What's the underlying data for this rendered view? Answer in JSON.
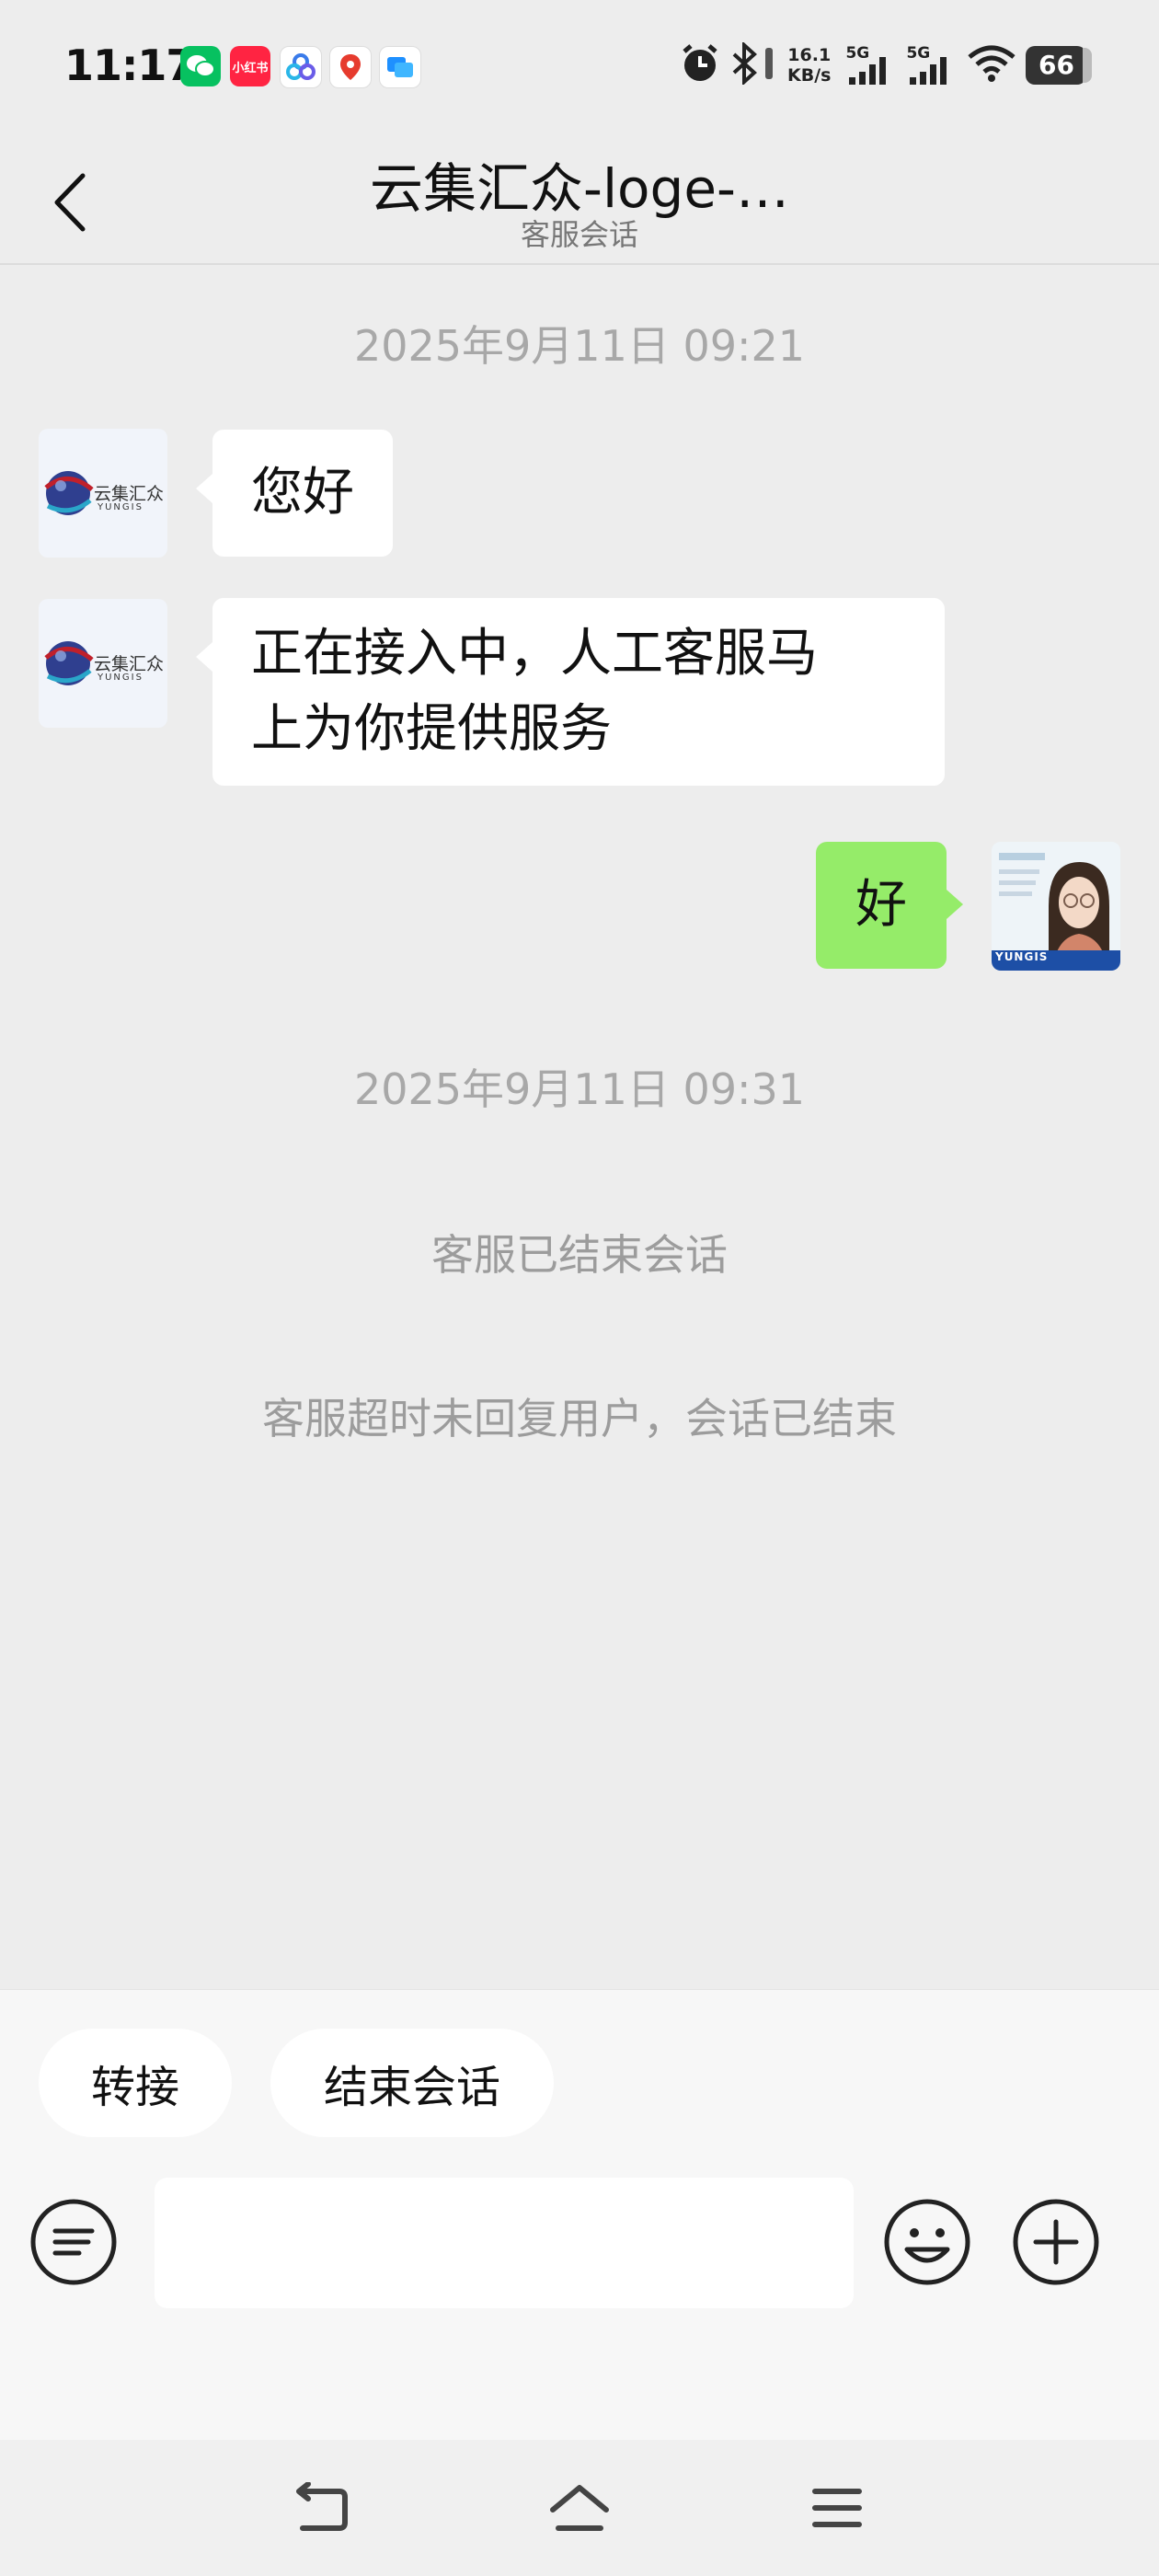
{
  "status_bar": {
    "time": "11:17",
    "notif_icons": [
      "wechat-icon",
      "xiaohongshu-icon",
      "cloud-app-icon",
      "map-pin-icon",
      "message-app-icon"
    ],
    "xiaohongshu_label": "小红书",
    "net_speed_value": "16.1",
    "net_speed_unit": "KB/s",
    "sim1_label": "5G",
    "sim2_label": "5G",
    "battery": "66"
  },
  "header": {
    "title": "云集汇众-loge-…",
    "subtitle": "客服会话"
  },
  "chat": {
    "bot_logo_text": "云集汇众",
    "bot_logo_sub": "YUNGIS",
    "timestamp_1": "2025年9月11日 09:21",
    "msg_1": "您好",
    "msg_2_line1": "正在接入中，人工客服马",
    "msg_2_line2": "上为你提供服务",
    "msg_3": "好",
    "user_card_brand": "YUNGIS",
    "timestamp_2": "2025年9月11日 09:31",
    "system_1": "客服已结束会话",
    "system_2": "客服超时未回复用户，会话已结束"
  },
  "actions": {
    "transfer_label": "转接",
    "end_session_label": "结束会话"
  },
  "input": {
    "value": "",
    "placeholder": ""
  },
  "colors": {
    "background": "#ededed",
    "bubble_self": "#95ec69",
    "bubble_other": "#ffffff",
    "wechat_green": "#07c160",
    "xiaohongshu_red": "#ff2442"
  }
}
